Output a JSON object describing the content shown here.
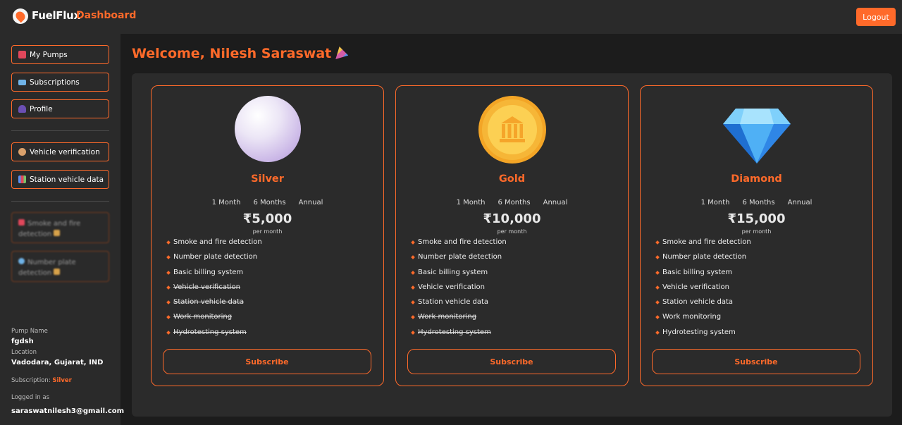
{
  "header": {
    "brand": "FuelFlux",
    "section": "Dashboard",
    "logout_label": "Logout"
  },
  "sidebar": {
    "items": [
      {
        "label": "My Pumps",
        "icon": "fuel-pump-icon"
      },
      {
        "label": "Subscriptions",
        "icon": "credit-card-icon"
      },
      {
        "label": "Profile",
        "icon": "person-icon"
      },
      {
        "label": "Vehicle verification",
        "icon": "police-officer-icon"
      },
      {
        "label": "Station vehicle data",
        "icon": "bar-chart-icon"
      }
    ],
    "locked_items": [
      {
        "label": "Smoke and fire detection",
        "icon": "siren-icon"
      },
      {
        "label": "Number plate detection",
        "icon": "magnifier-icon"
      }
    ],
    "pump_name_label": "Pump Name",
    "pump_name": "fgdsh",
    "location_label": "Location",
    "location": "Vadodara, Gujarat, IND",
    "subscription_label": "Subscription:",
    "subscription": "Silver",
    "logged_in_label": "Logged in as",
    "email": "saraswatnilesh3@gmail.com"
  },
  "main": {
    "welcome": "Welcome, Nilesh Saraswat",
    "welcome_icon": "party-popper-icon",
    "periods": [
      "1 Month",
      "6 Months",
      "Annual"
    ],
    "per_label": "per month",
    "subscribe_label": "Subscribe",
    "plans": [
      {
        "name": "Silver",
        "price": "₹5,000",
        "emblem": "pearl-icon",
        "features": [
          {
            "text": "Smoke and fire detection",
            "included": true
          },
          {
            "text": "Number plate detection",
            "included": true
          },
          {
            "text": "Basic billing system",
            "included": true
          },
          {
            "text": "Vehicle verification",
            "included": false
          },
          {
            "text": "Station vehicle data",
            "included": false
          },
          {
            "text": "Work monitoring",
            "included": false
          },
          {
            "text": "Hydrotesting system",
            "included": false
          }
        ]
      },
      {
        "name": "Gold",
        "price": "₹10,000",
        "emblem": "gold-coin-bank-icon",
        "features": [
          {
            "text": "Smoke and fire detection",
            "included": true
          },
          {
            "text": "Number plate detection",
            "included": true
          },
          {
            "text": "Basic billing system",
            "included": true
          },
          {
            "text": "Vehicle verification",
            "included": true
          },
          {
            "text": "Station vehicle data",
            "included": true
          },
          {
            "text": "Work monitoring",
            "included": false
          },
          {
            "text": "Hydrotesting system",
            "included": false
          }
        ]
      },
      {
        "name": "Diamond",
        "price": "₹15,000",
        "emblem": "diamond-icon",
        "features": [
          {
            "text": "Smoke and fire detection",
            "included": true
          },
          {
            "text": "Number plate detection",
            "included": true
          },
          {
            "text": "Basic billing system",
            "included": true
          },
          {
            "text": "Vehicle verification",
            "included": true
          },
          {
            "text": "Station vehicle data",
            "included": true
          },
          {
            "text": "Work monitoring",
            "included": true
          },
          {
            "text": "Hydrotesting system",
            "included": true
          }
        ]
      }
    ]
  },
  "colors": {
    "accent": "#ff6a2a",
    "background": "#1c1c1c",
    "panel": "#2b2b2b",
    "topbar": "#2a2a2a"
  }
}
